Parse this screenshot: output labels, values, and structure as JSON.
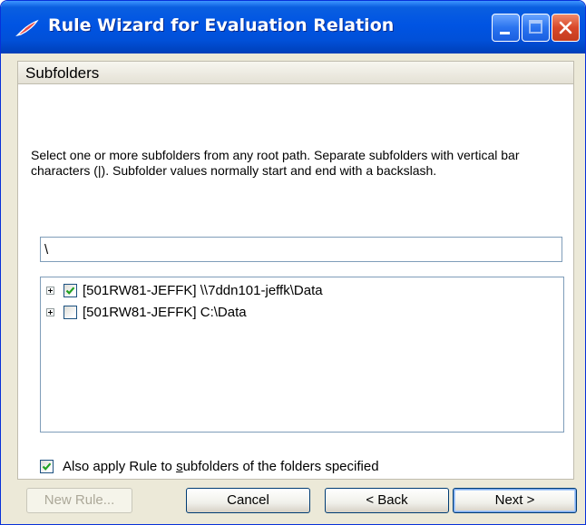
{
  "window": {
    "title": "Rule Wizard for Evaluation Relation"
  },
  "section": {
    "title": "Subfolders"
  },
  "instructions": "Select one or more subfolders from any root path. Separate subfolders with vertical bar characters (|). Subfolder values normally start and end with a backslash.",
  "subfolder_input": {
    "value": "\\"
  },
  "tree": {
    "nodes": [
      {
        "label": "[501RW81-JEFFK] \\\\7ddn101-jeffk\\Data",
        "checked": true
      },
      {
        "label": "[501RW81-JEFFK] C:\\Data",
        "checked": false
      }
    ]
  },
  "apply_subfolders": {
    "checked": true,
    "label_before": "Also apply Rule to ",
    "label_accel": "s",
    "label_after": "ubfolders of the folders specified"
  },
  "buttons": {
    "new_rule": "New Rule...",
    "cancel": "Cancel",
    "back": "< Back",
    "next": "Next >"
  },
  "colors": {
    "titlebar": "#0054e3",
    "face": "#ece9d8",
    "check_green": "#21a121"
  },
  "icons": {
    "title_icon": "feather-pen-icon",
    "minimize": "minimize-icon",
    "maximize": "maximize-icon",
    "close": "close-icon",
    "expand": "plus-expander-icon",
    "check": "checkmark-icon"
  }
}
